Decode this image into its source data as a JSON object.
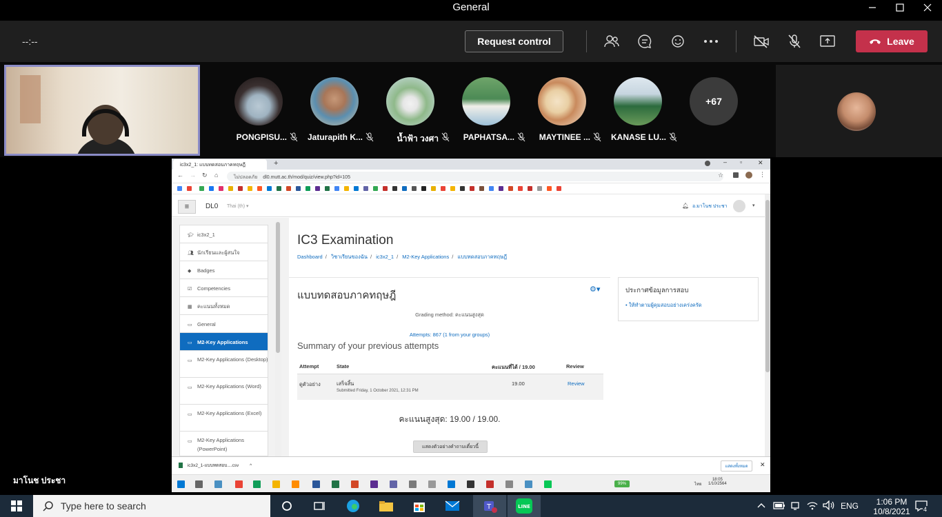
{
  "window": {
    "title": "General"
  },
  "meeting": {
    "timer": "--:--",
    "request_control": "Request control",
    "leave": "Leave",
    "speaker_name": "มาโนช ประชา",
    "more_count": "+67",
    "participants": [
      {
        "name": "PONGPISU..."
      },
      {
        "name": "Jaturapith K..."
      },
      {
        "name": "น้ำฟ้า วงศา"
      },
      {
        "name": "PAPHATSA..."
      },
      {
        "name": "MAYTINEE ..."
      },
      {
        "name": "KANASE LU..."
      }
    ]
  },
  "browser": {
    "tab_title": "ic3x2_1: แบบทดสอบภาคทฤษฎี",
    "url_security": "ไม่ปลอดภัย",
    "url": "dl0.mutt.ac.th/mod/quiz/view.php?id=105"
  },
  "moodle": {
    "site_name": "DL0",
    "language": "Thai (th) ▾",
    "user_name": "อ.มาโนช ประชา",
    "page_title": "IC3 Examination",
    "breadcrumbs": [
      "Dashboard",
      "วิชาเรียนของฉัน",
      "ic3x2_1",
      "M2-Key Applications",
      "แบบทดสอบภาคทฤษฎี"
    ],
    "sidenav": [
      {
        "icon": "graduation-cap-icon",
        "label": "ic3x2_1"
      },
      {
        "icon": "users-icon",
        "label": "นักเรียนและผู้สนใจ"
      },
      {
        "icon": "badge-icon",
        "label": "Badges"
      },
      {
        "icon": "checkbox-icon",
        "label": "Competencies"
      },
      {
        "icon": "table-icon",
        "label": "คะแนนทั้งหมด"
      },
      {
        "icon": "folder-icon",
        "label": "General"
      },
      {
        "icon": "folder-icon",
        "label": "M2-Key Applications",
        "active": true
      },
      {
        "icon": "folder-icon",
        "label": "M2-Key Applications (Desktop)"
      },
      {
        "icon": "folder-icon",
        "label": "M2-Key Applications (Word)"
      },
      {
        "icon": "folder-icon",
        "label": "M2-Key Applications (Excel)"
      },
      {
        "icon": "folder-icon",
        "label": "M2-Key Applications (PowerPoint)"
      }
    ],
    "quiz_title": "แบบทดสอบภาคทฤษฎี",
    "grading_method": "Grading method: คะแนนสูงสุด",
    "attempts": "Attempts: 867 (1 from your groups)",
    "summary_heading": "Summary of your previous attempts",
    "table": {
      "headers": [
        "Attempt",
        "State",
        "คะแนนที่ได้ / 19.00",
        "Review"
      ],
      "rows": [
        {
          "attempt": "ดูตัวอย่าง",
          "state": "เสร็จสิ้น",
          "submitted": "Submitted Friday, 1 October 2021, 12:31 PM",
          "score": "19.00",
          "review": "Review"
        }
      ]
    },
    "highest_grade_label": "คะแนนสูงสุด:",
    "highest_grade_value": "19.00 / 19.00.",
    "preview_button": "แสดงตัวอย่างคำถามเดี๋ยวนี้",
    "info_block_title": "ประกาศข้อมูลการสอบ",
    "info_block_item": "ให้ทำตามผู้คุมสอบอย่างเคร่งครัด"
  },
  "download_bar": {
    "file": "ic3x2_1-แบบทดสอบ....csv",
    "show_all": "แสดงทั้งหมด"
  },
  "inner_taskbar": {
    "battery": "99%",
    "time": "18:05",
    "date": "1/10/2564",
    "lang": "ไทย"
  },
  "taskbar": {
    "search_placeholder": "Type here to search",
    "language": "ENG",
    "time": "1:06 PM",
    "date": "10/8/2021",
    "notifications": "4"
  },
  "colors": {
    "leave": "#c4314b",
    "moodle_blue": "#0f6cbf",
    "self_border": "#8b8cc7"
  }
}
